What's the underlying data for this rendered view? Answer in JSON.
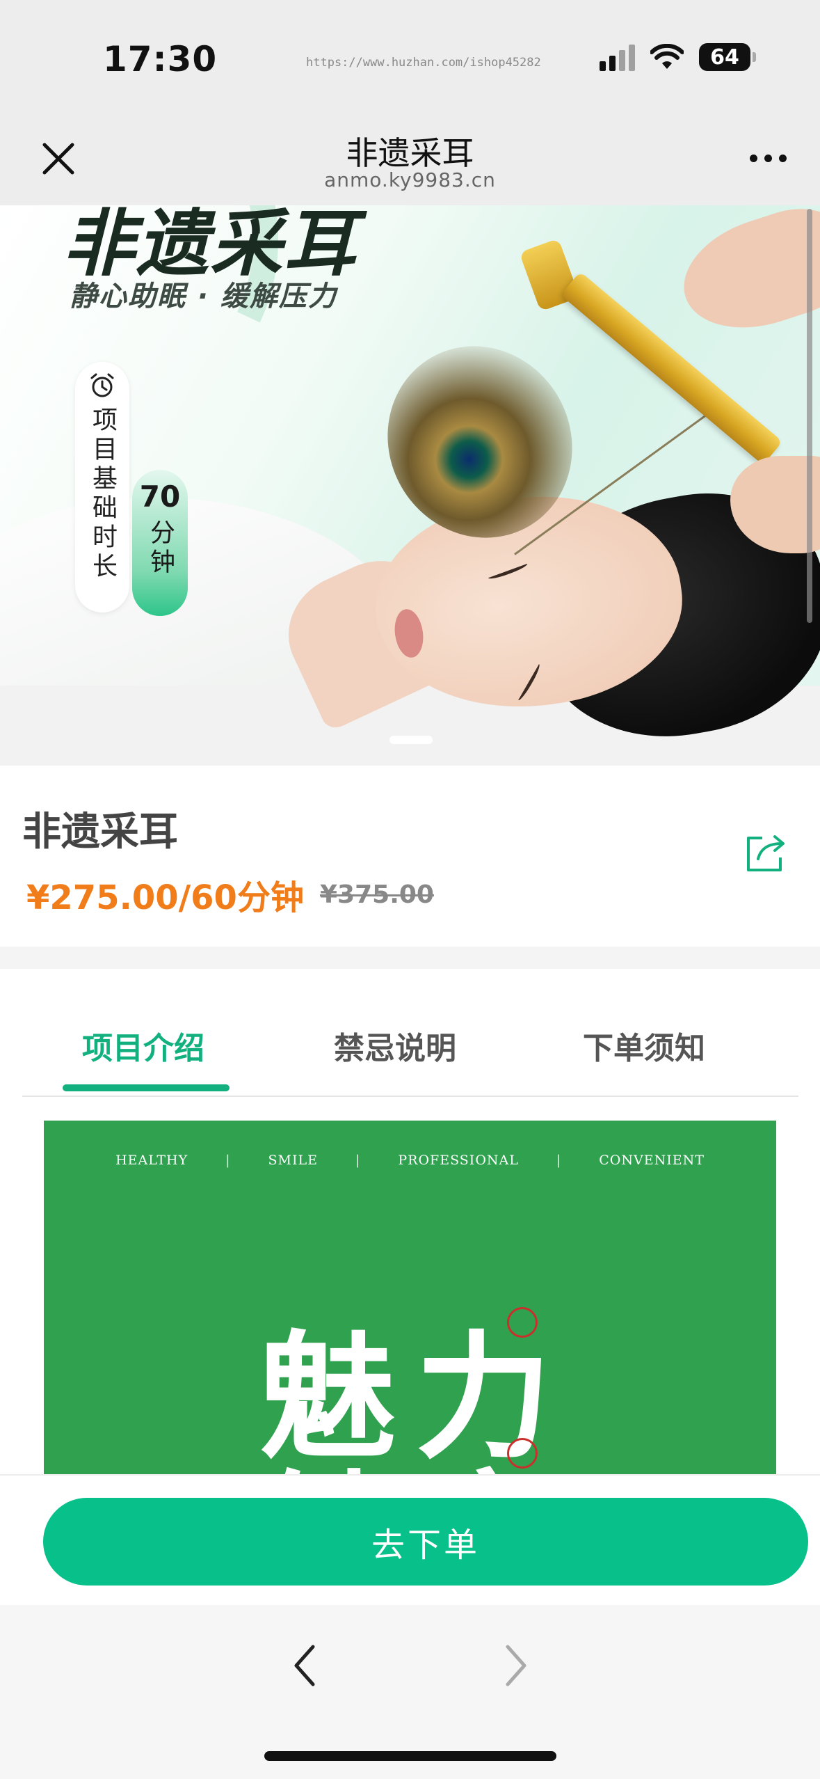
{
  "status_bar": {
    "time": "17:30",
    "url_watermark": "https://www.huzhan.com/ishop45282",
    "battery": "64"
  },
  "nav": {
    "title": "非遗采耳",
    "subtitle": "anmo.ky9983.cn"
  },
  "hero": {
    "title": "非遗采耳",
    "subtitle": "静心助眠 · 缓解压力",
    "duration_label": "项目基础时长",
    "duration_value": "70",
    "duration_unit": "分钟"
  },
  "product": {
    "name": "非遗采耳",
    "price": "¥275.00/60分钟",
    "original_price": "¥375.00"
  },
  "tabs": [
    {
      "label": "项目介绍"
    },
    {
      "label": "禁忌说明"
    },
    {
      "label": "下单须知"
    }
  ],
  "promo": {
    "tags": [
      "HEALTHY",
      "SMILE",
      "PROFESSIONAL",
      "CONVENIENT"
    ],
    "separator": "|",
    "headline": "魅力",
    "headline2": "健康"
  },
  "actions": {
    "order_label": "去下单"
  },
  "colors": {
    "accent": "#13b07f",
    "button": "#07c08a",
    "price": "#f07c1a",
    "promo_bg": "#30a24f"
  }
}
